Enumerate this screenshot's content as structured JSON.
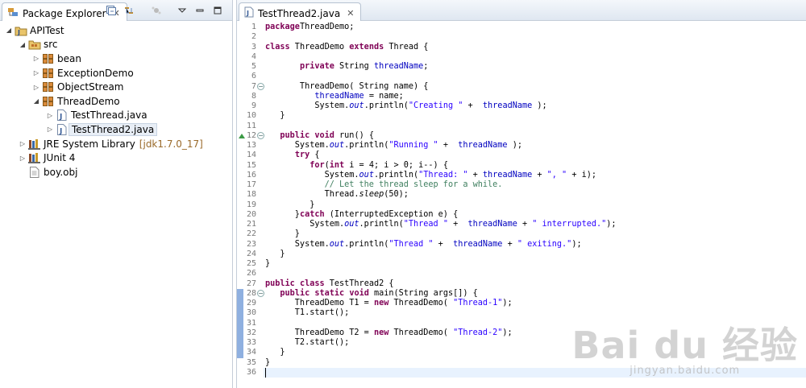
{
  "package_explorer": {
    "tab_title": "Package Explorer",
    "tree": [
      {
        "label": "APITest",
        "depth": 0,
        "arrow": "open",
        "icon": "project-icon"
      },
      {
        "label": "src",
        "depth": 1,
        "arrow": "open",
        "icon": "source-folder-icon"
      },
      {
        "label": "bean",
        "depth": 2,
        "arrow": "closed",
        "icon": "package-icon"
      },
      {
        "label": "ExceptionDemo",
        "depth": 2,
        "arrow": "closed",
        "icon": "package-icon"
      },
      {
        "label": "ObjectStream",
        "depth": 2,
        "arrow": "closed",
        "icon": "package-icon"
      },
      {
        "label": "ThreadDemo",
        "depth": 2,
        "arrow": "open",
        "icon": "package-icon"
      },
      {
        "label": "TestThread.java",
        "depth": 3,
        "arrow": "closed",
        "icon": "java-file-icon"
      },
      {
        "label": "TestThread2.java",
        "depth": 3,
        "arrow": "closed",
        "icon": "java-file-icon",
        "selected": true
      },
      {
        "label": "JRE System Library",
        "decoration": "[jdk1.7.0_17]",
        "depth": 1,
        "arrow": "closed",
        "icon": "library-icon"
      },
      {
        "label": "JUnit 4",
        "depth": 1,
        "arrow": "closed",
        "icon": "library-icon"
      },
      {
        "label": "boy.obj",
        "depth": 1,
        "arrow": "none",
        "icon": "file-icon"
      }
    ]
  },
  "editor": {
    "tab_title": "TestThread2.java",
    "lines": [
      [
        [
          "k",
          "package"
        ],
        [
          "",
          "ThreadDemo;"
        ]
      ],
      [],
      [
        [
          "k",
          "class"
        ],
        [
          "",
          " ThreadDemo "
        ],
        [
          "k",
          "extends"
        ],
        [
          "",
          " Thread {"
        ]
      ],
      [],
      [
        [
          "",
          "       "
        ],
        [
          "k",
          "private"
        ],
        [
          "",
          " String "
        ],
        [
          "f",
          "threadName"
        ],
        [
          "",
          ";"
        ]
      ],
      [],
      [
        [
          "",
          "       ThreadDemo( String name) {"
        ]
      ],
      [
        [
          "",
          "          "
        ],
        [
          "f",
          "threadName"
        ],
        [
          "",
          " = name;"
        ]
      ],
      [
        [
          "",
          "          System."
        ],
        [
          "fi",
          "out"
        ],
        [
          "",
          ".println("
        ],
        [
          "s",
          "\"Creating \""
        ],
        [
          "",
          " +  "
        ],
        [
          "f",
          "threadName"
        ],
        [
          "",
          " );"
        ]
      ],
      [
        [
          "",
          "   }"
        ]
      ],
      [],
      [
        [
          "",
          "   "
        ],
        [
          "k",
          "public"
        ],
        [
          "",
          " "
        ],
        [
          "k",
          "void"
        ],
        [
          "",
          " run() {"
        ]
      ],
      [
        [
          "",
          "      System."
        ],
        [
          "fi",
          "out"
        ],
        [
          "",
          ".println("
        ],
        [
          "s",
          "\"Running \""
        ],
        [
          "",
          " +  "
        ],
        [
          "f",
          "threadName"
        ],
        [
          "",
          " );"
        ]
      ],
      [
        [
          "",
          "      "
        ],
        [
          "k",
          "try"
        ],
        [
          "",
          " {"
        ]
      ],
      [
        [
          "",
          "         "
        ],
        [
          "k",
          "for"
        ],
        [
          "",
          "("
        ],
        [
          "k",
          "int"
        ],
        [
          "",
          " i = 4; i > 0; i--) {"
        ]
      ],
      [
        [
          "",
          "            System."
        ],
        [
          "fi",
          "out"
        ],
        [
          "",
          ".println("
        ],
        [
          "s",
          "\"Thread: \""
        ],
        [
          "",
          " + "
        ],
        [
          "f",
          "threadName"
        ],
        [
          "",
          " + "
        ],
        [
          "s",
          "\", \""
        ],
        [
          "",
          " + i);"
        ]
      ],
      [
        [
          "",
          "            "
        ],
        [
          "c",
          "// Let the thread sleep for a while."
        ]
      ],
      [
        [
          "",
          "            Thread."
        ],
        [
          "m",
          "sleep"
        ],
        [
          "",
          "(50);"
        ]
      ],
      [
        [
          "",
          "         }"
        ]
      ],
      [
        [
          "",
          "      }"
        ],
        [
          "k",
          "catch"
        ],
        [
          "",
          " (InterruptedException e) {"
        ]
      ],
      [
        [
          "",
          "         System."
        ],
        [
          "fi",
          "out"
        ],
        [
          "",
          ".println("
        ],
        [
          "s",
          "\"Thread \""
        ],
        [
          "",
          " +  "
        ],
        [
          "f",
          "threadName"
        ],
        [
          "",
          " + "
        ],
        [
          "s",
          "\" interrupted.\""
        ],
        [
          "",
          ");"
        ]
      ],
      [
        [
          "",
          "      }"
        ]
      ],
      [
        [
          "",
          "      System."
        ],
        [
          "fi",
          "out"
        ],
        [
          "",
          ".println("
        ],
        [
          "s",
          "\"Thread \""
        ],
        [
          "",
          " +  "
        ],
        [
          "f",
          "threadName"
        ],
        [
          "",
          " + "
        ],
        [
          "s",
          "\" exiting.\""
        ],
        [
          "",
          ");"
        ]
      ],
      [
        [
          "",
          "   }"
        ]
      ],
      [
        [
          "",
          "}"
        ]
      ],
      [],
      [
        [
          "k",
          "public"
        ],
        [
          "",
          " "
        ],
        [
          "k",
          "class"
        ],
        [
          "",
          " TestThread2 {"
        ]
      ],
      [
        [
          "",
          "   "
        ],
        [
          "k",
          "public"
        ],
        [
          "",
          " "
        ],
        [
          "k",
          "static"
        ],
        [
          "",
          " "
        ],
        [
          "k",
          "void"
        ],
        [
          "",
          " main(String args[]) {"
        ]
      ],
      [
        [
          "",
          "      ThreadDemo T1 = "
        ],
        [
          "k",
          "new"
        ],
        [
          "",
          " ThreadDemo( "
        ],
        [
          "s",
          "\"Thread-1\""
        ],
        [
          "",
          ");"
        ]
      ],
      [
        [
          "",
          "      T1.start();"
        ]
      ],
      [],
      [
        [
          "",
          "      ThreadDemo T2 = "
        ],
        [
          "k",
          "new"
        ],
        [
          "",
          " ThreadDemo( "
        ],
        [
          "s",
          "\"Thread-2\""
        ],
        [
          "",
          ");"
        ]
      ],
      [
        [
          "",
          "      T2.start();"
        ]
      ],
      [
        [
          "",
          "   }"
        ]
      ],
      [
        [
          "",
          "}"
        ]
      ],
      []
    ],
    "fold_lines": [
      7,
      12,
      28
    ],
    "override_lines": [
      12
    ],
    "changed_lines": [
      28,
      29,
      30,
      31,
      32,
      33,
      34
    ],
    "cursor_line": 36
  },
  "watermark": {
    "brand": "Bai du 经验",
    "url": "jingyan.baidu.com"
  }
}
